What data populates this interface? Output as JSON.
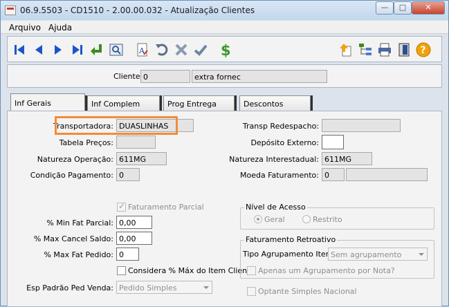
{
  "window": {
    "title": "06.9.5503 - CD1510 - 2.00.00.032 - Atualização Clientes",
    "btn_minimize": "—",
    "btn_maximize": "□",
    "btn_close": "✕"
  },
  "menu": [
    "Arquivo",
    "Ajuda"
  ],
  "toolbar": {
    "colors": {
      "nav": "#1d54c9",
      "save": "#3d8a1f",
      "dollar": "#3c9a2a",
      "help": "#f2a20a"
    },
    "icons": [
      "first-record-icon",
      "previous-record-icon",
      "next-record-icon",
      "last-record-icon",
      "return-icon",
      "search-record-icon",
      "font-edit-icon",
      "undo-icon",
      "delete-icon",
      "confirm-icon",
      "dollar-icon",
      "navigate-up-icon",
      "hierarchy-icon",
      "print-icon",
      "exit-door-icon",
      "help-icon"
    ]
  },
  "client": {
    "label": "Cliente:",
    "code": "0",
    "name": "extra fornec"
  },
  "tabs": [
    "Inf Gerais",
    "Inf Complem",
    "Prog Entrega",
    "Descontos"
  ],
  "fields": {
    "transportadora_label": "Transportadora:",
    "transportadora_value": "DUASLINHAS",
    "tabela_precos_label": "Tabela Preços:",
    "tabela_precos_value": "",
    "natureza_operacao_label": "Natureza Operação:",
    "natureza_operacao_value": "611MG",
    "condicao_pagamento_label": "Condição Pagamento:",
    "condicao_pagamento_value": "0",
    "transp_redespacho_label": "Transp Redespacho:",
    "transp_redespacho_value": "",
    "deposito_externo_label": "Depósito Externo:",
    "deposito_externo_value": "",
    "natureza_interestadual_label": "Natureza Interestadual:",
    "natureza_interestadual_value": "611MG",
    "moeda_faturamento_label": "Moeda Faturamento:",
    "moeda_faturamento_value": "0",
    "faturamento_parcial_label": "Faturamento Parcial",
    "pct_min_fat_parcial_label": "% Min Fat Parcial:",
    "pct_min_fat_parcial_value": "0,00",
    "pct_max_cancel_saldo_label": "% Max Cancel Saldo:",
    "pct_max_cancel_saldo_value": "0,00",
    "pct_max_fat_pedido_label": "% Max Fat Pedido:",
    "pct_max_fat_pedido_value": "0",
    "considera_pct_label": "Considera % Máx do Item Cliente",
    "esp_padrao_label": "Esp Padrão Ped Venda:",
    "esp_padrao_value": "Pedido Simples"
  },
  "nivel_acesso": {
    "title": "Nível de Acesso",
    "option_geral": "Geral",
    "option_restrito": "Restrito"
  },
  "faturamento_retroativo": {
    "title": "Faturamento Retroativo",
    "tipo_label": "Tipo Agrupamento Itens:",
    "tipo_value": "Sem agrupamento",
    "apenas_um_label": "Apenas um Agrupamento por Nota?"
  },
  "optante_simples_label": "Optante Simples Nacional"
}
